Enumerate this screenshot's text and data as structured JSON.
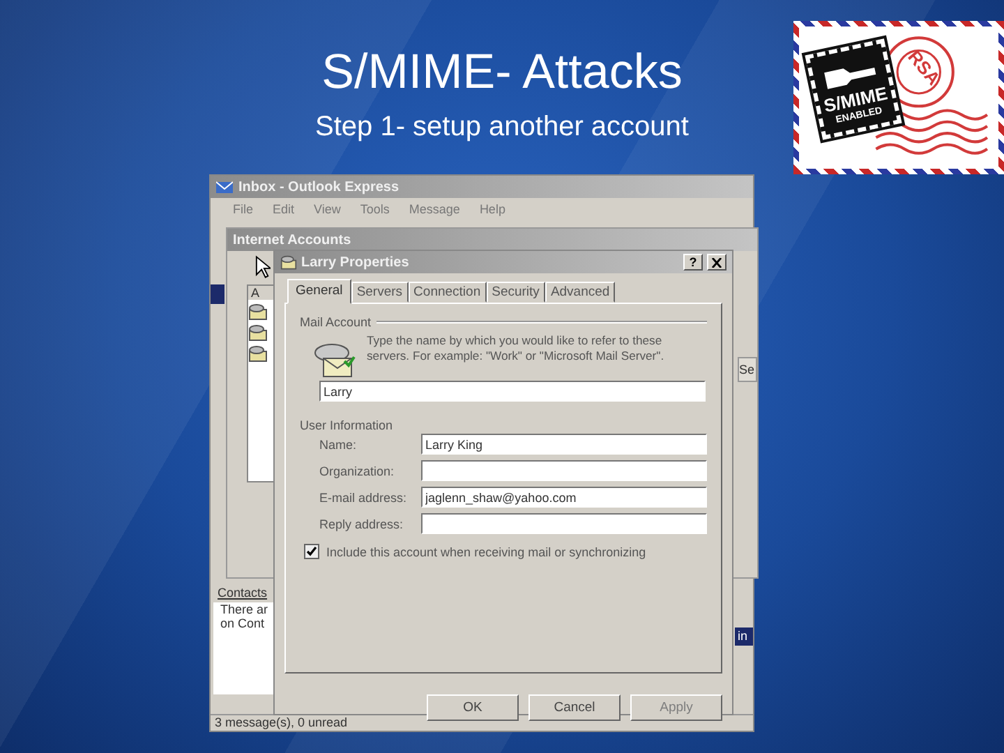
{
  "slide": {
    "title": "S/MIME- Attacks",
    "subtitle": "Step 1- setup another account"
  },
  "logo": {
    "stamp_text": "S/MIME",
    "stamp_subtext": "ENABLED",
    "postmark": "RSA"
  },
  "main_window": {
    "title": "Inbox - Outlook Express",
    "menu": [
      "File",
      "Edit",
      "View",
      "Tools",
      "Message",
      "Help"
    ],
    "contacts": {
      "heading": "Contacts",
      "lines": [
        "There ar",
        "on Cont"
      ]
    },
    "selected_fragment": "in",
    "status_bar": "3 message(s), 0 unread"
  },
  "accounts_window": {
    "title": "Internet Accounts",
    "list_header": "A",
    "side_button": "Se"
  },
  "dialog": {
    "title": "Larry Properties",
    "help_button": "?",
    "tabs": [
      {
        "label": "General",
        "selected": true
      },
      {
        "label": "Servers",
        "selected": false
      },
      {
        "label": "Connection",
        "selected": false
      },
      {
        "label": "Security",
        "selected": false
      },
      {
        "label": "Advanced",
        "selected": false
      }
    ],
    "mail_account": {
      "heading": "Mail Account",
      "hint": "Type the name by which you would like to refer to these servers. For example: \"Work\" or \"Microsoft Mail Server\".",
      "value": "Larry"
    },
    "user_information": {
      "heading": "User Information",
      "fields": [
        {
          "label": "Name:",
          "value": "Larry King"
        },
        {
          "label": "Organization:"
        },
        {
          "label": "E-mail address:",
          "value": "jaglenn_shaw@yahoo.com"
        },
        {
          "label": "Reply address:"
        }
      ]
    },
    "include_account": {
      "label": "Include this account when receiving mail or synchronizing",
      "checked": true
    },
    "buttons": [
      {
        "label": "OK",
        "disabled": false
      },
      {
        "label": "Cancel",
        "disabled": false
      },
      {
        "label": "Apply",
        "disabled": true
      }
    ]
  }
}
